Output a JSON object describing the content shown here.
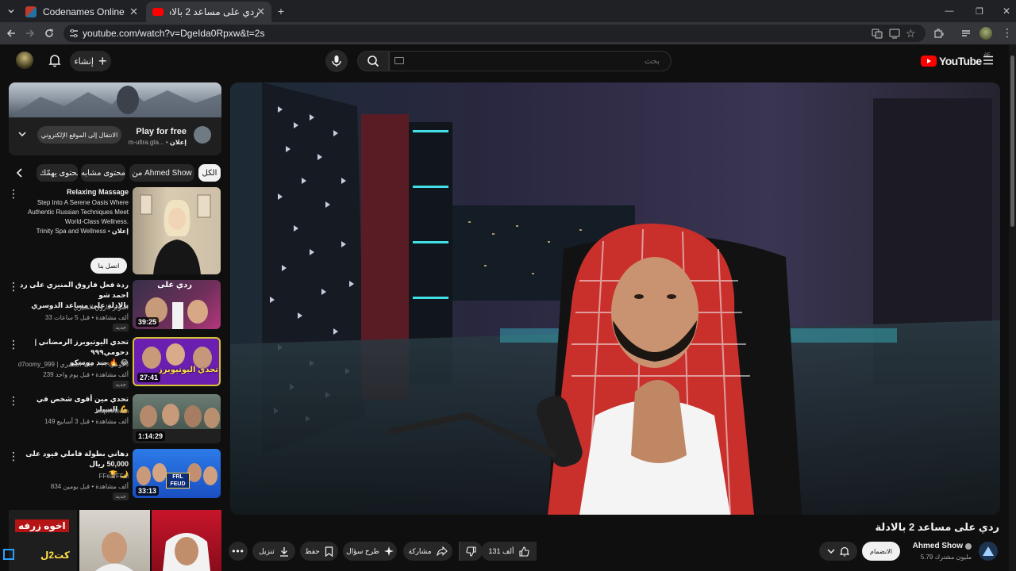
{
  "browser": {
    "tabs": [
      {
        "title": "Codenames Online"
      },
      {
        "title": "ردي على مساعد 2 بالادلة - YouTube"
      }
    ],
    "url": "youtube.com/watch?v=DgeIda0Rpxw&t=2s"
  },
  "masthead": {
    "create_label": "إنشاء",
    "search_placeholder": "بحث",
    "logo_text": "YouTube",
    "region": "AE"
  },
  "ad": {
    "title": "Play for free",
    "label": "إعلان",
    "domain": "m-ultra.gta...",
    "cta": "الانتقال إلى الموقع الإلكتروني"
  },
  "chips": [
    "الكل",
    "من Ahmed Show",
    "محتوى مشابه",
    "محتوى يهمّك"
  ],
  "sponsored": {
    "title": "Relaxing Massage",
    "desc1": "Step Into A Serene Oasis Where",
    "desc2": "Authentic Russian Techniques Meet",
    "desc3": "World-Class Wellness.",
    "advertiser": "Trinity Spa and Wellness",
    "label": "إعلان",
    "cta": "اتصل بنا"
  },
  "videos": [
    {
      "title1": "ردة فعل فاروق المنيزي على رد احمد شو",
      "title2": "بالادلة على مساعد الدوسري",
      "channel": "المؤثر فاروق المنيزي",
      "meta": "33 ألف مشاهدة • قبل 5 ساعات",
      "badge": "جديد",
      "duration": "39:25",
      "thumb_text": "ردي على"
    },
    {
      "title1": "تحدي اليوتيوبرز الرمضاني | دحومي٩٩٩",
      "title2": "ضد موسكو 🔥 😂",
      "channel": "d7oomy_999 | دحومي٩٩٩ ، عايد الشمري",
      "meta": "239 ألف مشاهدة • قبل يوم واحد",
      "badge": "جديد",
      "duration": "27:41",
      "thumb_text": "تحدي اليوتيوبرز"
    },
    {
      "title1": "تحدي مين أقوى شخص في السيلر 💪",
      "title2": "",
      "channel": "Inspireteam",
      "meta": "149 ألف مشاهدة • قبل 3 أسابيع",
      "badge": "",
      "duration": "1:14:29",
      "thumb_text": ""
    },
    {
      "title1": "دهاني بطولة فاملي فيود على 50,000 ريال",
      "title2": "🏆 🌙",
      "channel": "FFearFFul",
      "meta": "834 ألف مشاهدة • قبل يومين",
      "badge": "جديد",
      "duration": "33:13",
      "thumb_text": "FRL FEUD"
    }
  ],
  "bottom_thumbs": {
    "text1": "اخوه زرفه",
    "text2": "كت2ل"
  },
  "video": {
    "title": "ردي على مساعد 2 بالادلة",
    "channel": "Ahmed Show",
    "subscribers": "5.79 مليون مشترك",
    "join_label": "الانضمام",
    "likes": "131 ألف",
    "share_label": "مشاركة",
    "ask_label": "طرح سؤال",
    "save_label": "حفظ",
    "download_label": "تنزيل"
  },
  "colors": {
    "bg": "#0f0f0f",
    "chip": "#272727",
    "yt_red": "#ff0000",
    "thumb2_purple": "#6a1fb0",
    "thumb4_blue": "#1a4fc2"
  }
}
